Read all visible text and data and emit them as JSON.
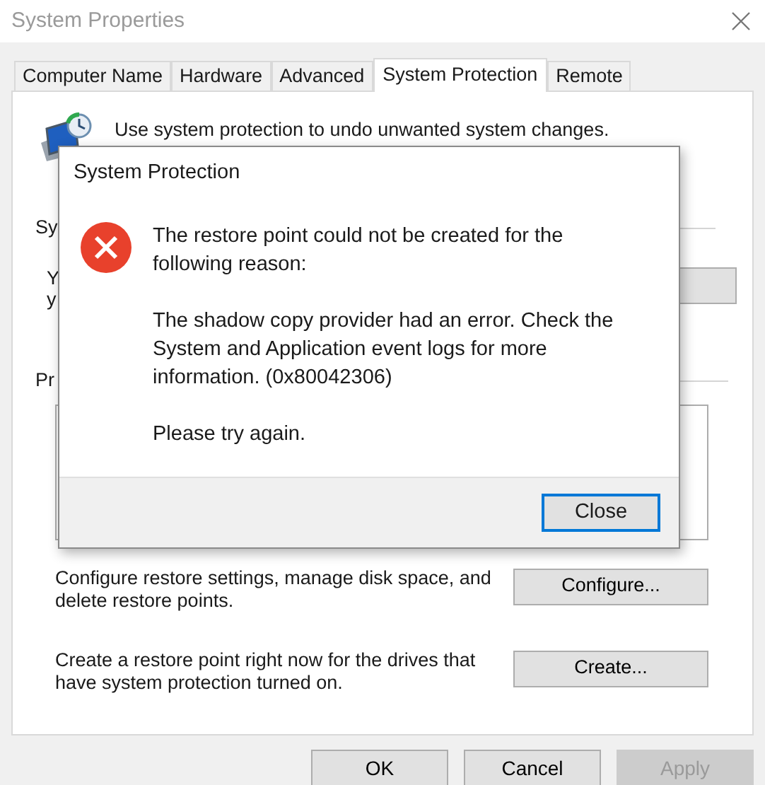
{
  "window": {
    "title": "System Properties"
  },
  "tabs": [
    {
      "label": "Computer Name",
      "selected": false
    },
    {
      "label": "Hardware",
      "selected": false
    },
    {
      "label": "Advanced",
      "selected": false
    },
    {
      "label": "System Protection",
      "selected": true
    },
    {
      "label": "Remote",
      "selected": false
    }
  ],
  "intro_text": "Use system protection to undo unwanted system changes.",
  "section_1": {
    "heading": "Sy",
    "text_lines": [
      "Y",
      "y"
    ]
  },
  "section_2": {
    "heading": "Pr"
  },
  "actions": [
    {
      "text": "Configure restore settings, manage disk space, and delete restore points.",
      "button": "Configure..."
    },
    {
      "text": "Create a restore point right now for the drives that have system protection turned on.",
      "button": "Create..."
    }
  ],
  "buttons": [
    {
      "label": "OK",
      "disabled": false
    },
    {
      "label": "Cancel",
      "disabled": false
    },
    {
      "label": "Apply",
      "disabled": true
    }
  ],
  "dialog": {
    "title": "System Protection",
    "paragraphs": [
      "The restore point could not be created for the following reason:",
      "The shadow copy provider had an error. Check the System and Application event logs for more information. (0x80042306)",
      "Please try again."
    ],
    "button": "Close"
  }
}
